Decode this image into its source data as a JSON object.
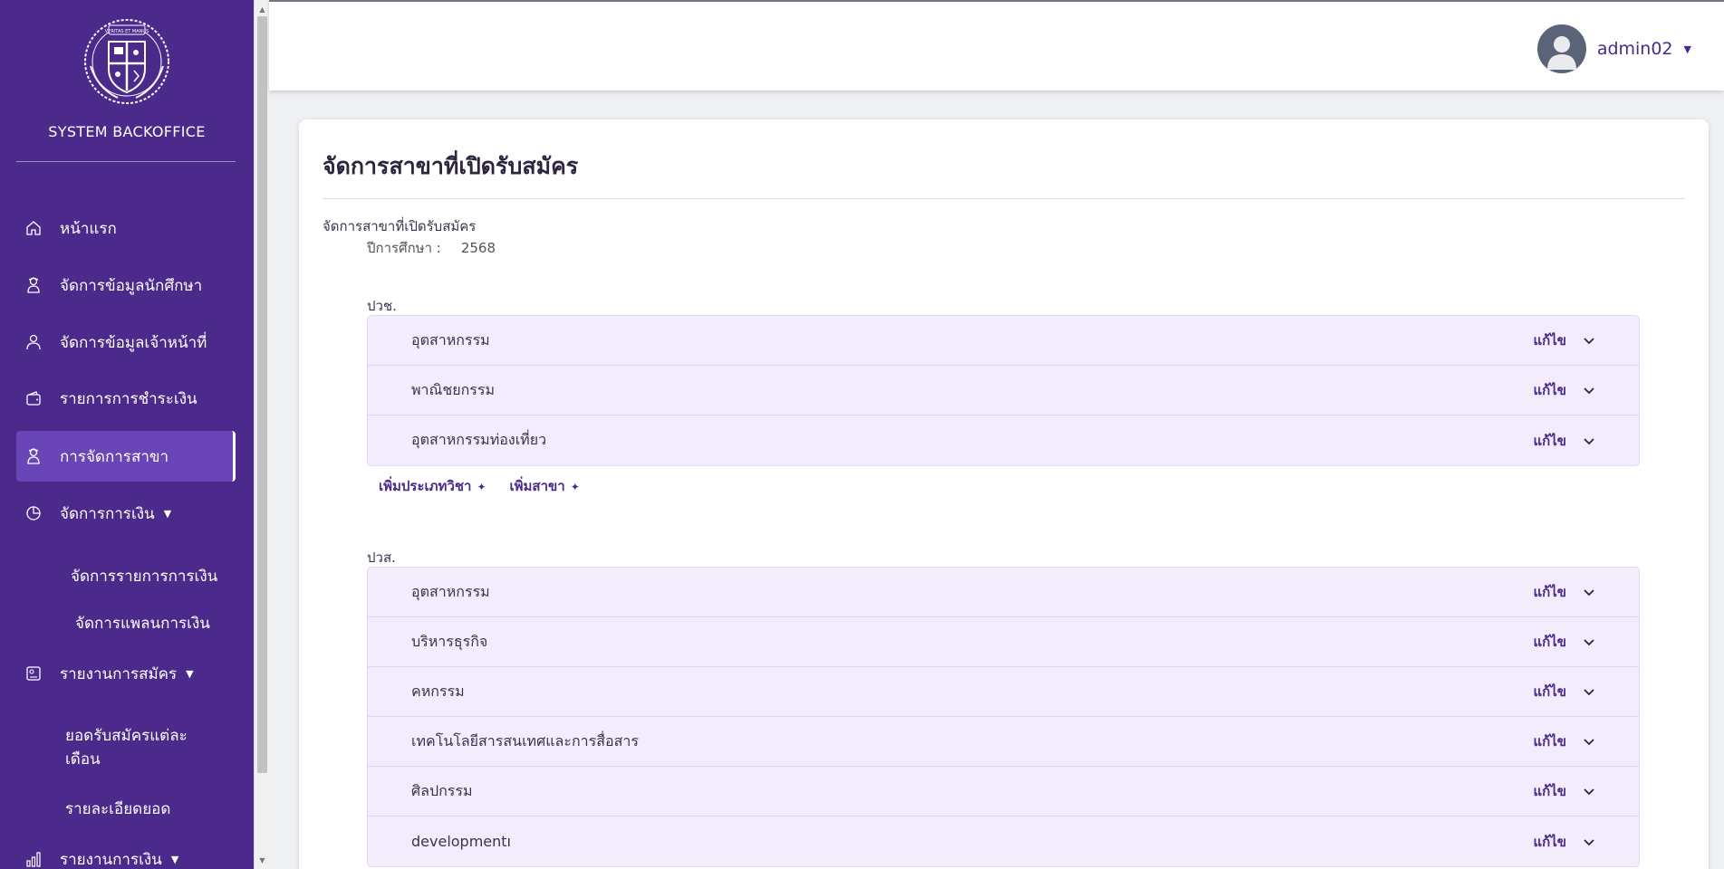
{
  "sidebar": {
    "logo_motto": "VERITAS ET MANUS",
    "brand": "SYSTEM BACKOFFICE",
    "items": [
      {
        "label": "หน้าแรก"
      },
      {
        "label": "จัดการข้อมูลนักศึกษา"
      },
      {
        "label": "จัดการข้อมูลเจ้าหน้าที่"
      },
      {
        "label": "รายการการชำระเงิน"
      },
      {
        "label": "การจัดการสาขา"
      },
      {
        "label": "จัดการการเงิน"
      },
      {
        "label": "รายงานการสมัคร"
      },
      {
        "label": "รายงานการเงิน"
      }
    ],
    "finance_sub": [
      "จัดการรายการการเงิน",
      "จัดการแพลนการเงิน"
    ],
    "report_sub": [
      "ยอดรับสมัครแต่ละเดือน",
      "รายละเอียดยอด"
    ]
  },
  "topbar": {
    "username": "admin02"
  },
  "main": {
    "title": "จัดการสาขาที่เปิดรับสมัคร",
    "section_label": "จัดการสาขาที่เปิดรับสมัคร",
    "year_label": "ปีการศึกษา :",
    "year_value": "2568",
    "edit_label": "แก้ไข",
    "add_type_label": "เพิ่มประเภทวิชา",
    "add_branch_label": "เพิ่มสาขา",
    "groups": [
      {
        "label": "ปวช.",
        "rows": [
          "อุตสาหกรรม",
          "พาณิชยกรรม",
          "อุตสาหกรรมท่องเที่ยว"
        ]
      },
      {
        "label": "ปวส.",
        "rows": [
          "อุตสาหกรรม",
          "บริหารธุรกิจ",
          "คหกรรม",
          "เทคโนโลยีสารสนเทศและการสื่อสาร",
          "ศิลปกรรม",
          "developmentı"
        ]
      }
    ]
  },
  "colors": {
    "sidebar": "#4b2a8c",
    "active": "#6a45b8",
    "row_bg": "#f3ecfc",
    "accent": "#4b2a8c"
  }
}
